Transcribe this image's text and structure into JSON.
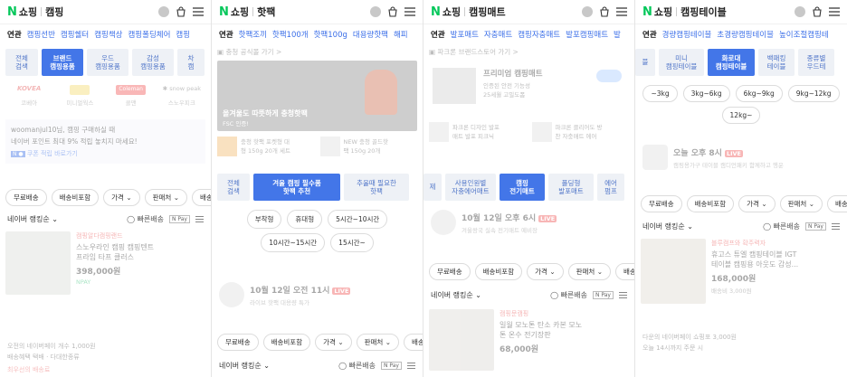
{
  "panels": [
    {
      "title": "캠핑",
      "related": [
        "캠핑선반",
        "캠핑쉘터",
        "캠핑책상",
        "캠핑폴딩체어",
        "캠핑"
      ],
      "tiles": [
        {
          "label": "전체\n검색",
          "on": false
        },
        {
          "label": "브랜드\n캠핑용품",
          "on": true
        },
        {
          "label": "우드\n캠핑용품",
          "on": false
        },
        {
          "label": "감성\n캠핑용품",
          "on": false
        },
        {
          "label": "차\n캠",
          "on": false
        }
      ],
      "brands": [
        "KOVEA",
        "",
        "Coleman",
        "snow peak"
      ],
      "brand_names": [
        "코베아",
        "미니멀웍스",
        "콜맨",
        "스노우피크"
      ],
      "promo": {
        "line1": "woomanjul10님, 캠핑 구매하실 때",
        "line2": "네이버 포인트 최대 9% 적립 놓치지 마세요!",
        "tag": "쿠폰 적립 바로가기"
      },
      "filters": [
        "무료배송",
        "배송비포함",
        "가격",
        "판매처",
        "배송"
      ],
      "rank_label": "네이버 랭킹순",
      "fast_label": "빠른배송",
      "product": {
        "mall": "캠핑알다캠핑랜드",
        "name1": "스노우라인 캠핑 캠핑텐트",
        "name2": "프라임 타프 클러스",
        "price": "398,000원",
        "extra": "NPAY"
      },
      "footer": {
        "line1": "오전의 네이버페이 개수 1,000원",
        "line2": "배송혜택 택배 · 다대한종류"
      },
      "footer2": "최우선의 배송료"
    },
    {
      "title": "핫팩",
      "related": [
        "핫팩조끼",
        "핫팩100개",
        "핫팩100g",
        "대용량핫팩",
        "해피"
      ],
      "banner_top": "충청 공식몰 가기",
      "banner_big1": "올겨울도 따뜻하게 충청핫팩",
      "banner_big2": "FSC 인증!",
      "mini": [
        {
          "t": "충청 핫팩 포켓형 대",
          "s": "형 150g 20개 세트"
        },
        {
          "t": "NEW 충청 골드핫",
          "s": "팩 150g 20개"
        }
      ],
      "tiles": [
        {
          "label": "전체\n검색",
          "on": false
        },
        {
          "label": "겨울 캠핑 필수품\n핫팩 추천",
          "on": true
        },
        {
          "label": "추울때 필요한\n핫팩",
          "on": false
        }
      ],
      "chips": [
        "부착형",
        "휴대형",
        "5시간~10시간",
        "10시간~15시간",
        "15시간~"
      ],
      "live_title": "10월 12일 오전 11시",
      "live_badge": "LIVE",
      "live_sub": "라이브 핫팩 대용량 특가",
      "filters": [
        "무료배송",
        "배송비포함",
        "가격",
        "판매처",
        "배송"
      ],
      "rank_label": "네이버 랭킹순",
      "fast_label": "빠른배송"
    },
    {
      "title": "캠핑매트",
      "related": [
        "발포매트",
        "자충매트",
        "캠핑자충매트",
        "발포캠핑매트",
        "발"
      ],
      "brand_row": "파크론 브랜드스토어 가기",
      "prem1": "프리미엄 캠핑매트",
      "prem2": "인증된 안전 기능성",
      "prem3": "25세월 고밀도폼",
      "mini": [
        {
          "t": "파크론 디자인 발포",
          "s": "매트 발포 피크닉"
        },
        {
          "t": "파크론 클리어도 방",
          "s": "찬 자충매트 에어"
        }
      ],
      "tiles": [
        {
          "label": "제",
          "on": false
        },
        {
          "label": "사용인원별\n자충에어매트",
          "on": false
        },
        {
          "label": "캠핑\n전기매트",
          "on": true
        },
        {
          "label": "폴딩형\n발포매트",
          "on": false
        },
        {
          "label": "에어\n펌프",
          "on": false
        }
      ],
      "live_title": "10월 12일 오후 6시",
      "live_badge": "LIVE",
      "live_sub": "겨울왕국 실속 전기매트 예비장",
      "filters": [
        "무료배송",
        "배송비포함",
        "가격",
        "판매처",
        "배송"
      ],
      "rank_label": "네이버 랭킹순",
      "fast_label": "빠른배송",
      "product": {
        "mall": "캠핑문캠핑",
        "name1": "일월 모노톤 탄소 카본 모노",
        "name2": "톤 온수 전기장판",
        "price": "68,000원"
      }
    },
    {
      "title": "캠핑테이블",
      "related": [
        "경량캠핑테이블",
        "초경량캠핑테이블",
        "높이조절캠핑테"
      ],
      "tiles": [
        {
          "label": "블",
          "on": false
        },
        {
          "label": "미니\n캠핑테이블",
          "on": false
        },
        {
          "label": "화로대\n캠핑테이블",
          "on": true
        },
        {
          "label": "백패킹\n테이블",
          "on": false
        },
        {
          "label": "종류별\n우드테",
          "on": false
        }
      ],
      "chips": [
        "~3kg",
        "3kg~6kg",
        "6kg~9kg",
        "9kg~12kg",
        "12kg~"
      ],
      "live_title": "오늘 오후 8시",
      "live_badge": "LIVE",
      "live_sub": "캠핑용가구 테이블 캠디언패키 함께하고 행운",
      "filters": [
        "무료배송",
        "배송비포함",
        "가격",
        "판매처",
        "배송"
      ],
      "rank_label": "네이버 랭킹순",
      "fast_label": "빠른배송",
      "product": {
        "mall": "블루캠프와 확주력자",
        "name1": "휴고스 튜엘 캠핑테이블 IGT",
        "name2": "테이블 캠핑용 아웃도 감성...",
        "price": "168,000원",
        "sub": "배송비 3,000원"
      },
      "footer": {
        "line1": "다운의 네이버페이 쇼핑포 3,000원",
        "line2": "오늘 14시까지 주문 시"
      }
    }
  ],
  "colors": {
    "accent": "#4376e8",
    "naver_green": "#03c75a",
    "live_red": "#f04a4a"
  }
}
